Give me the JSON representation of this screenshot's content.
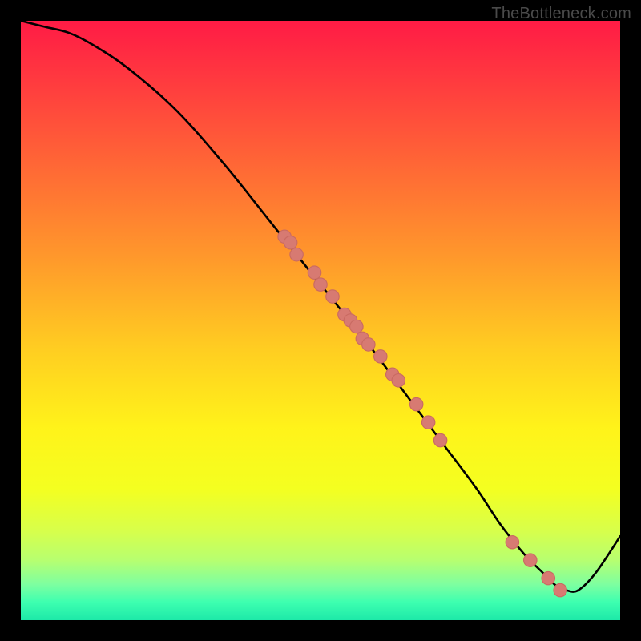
{
  "watermark": "TheBottleneck.com",
  "colors": {
    "black": "#000000",
    "curve": "#000000",
    "point_fill": "#d77a72",
    "point_stroke": "#c96a62",
    "gradient_stops": [
      {
        "offset": 0.0,
        "color": "#ff1b45"
      },
      {
        "offset": 0.1,
        "color": "#ff3a3f"
      },
      {
        "offset": 0.25,
        "color": "#ff6a35"
      },
      {
        "offset": 0.4,
        "color": "#ff9a2b"
      },
      {
        "offset": 0.55,
        "color": "#ffce21"
      },
      {
        "offset": 0.68,
        "color": "#fff31a"
      },
      {
        "offset": 0.78,
        "color": "#f4ff20"
      },
      {
        "offset": 0.85,
        "color": "#d8ff4a"
      },
      {
        "offset": 0.9,
        "color": "#b7ff70"
      },
      {
        "offset": 0.94,
        "color": "#7effa0"
      },
      {
        "offset": 0.97,
        "color": "#3dffb0"
      },
      {
        "offset": 1.0,
        "color": "#1de9a8"
      }
    ]
  },
  "chart_data": {
    "type": "line",
    "title": "",
    "xlabel": "",
    "ylabel": "",
    "xlim": [
      0,
      100
    ],
    "ylim": [
      0,
      100
    ],
    "series": [
      {
        "name": "curve",
        "x": [
          0,
          4,
          8,
          12,
          18,
          26,
          34,
          42,
          50,
          58,
          64,
          70,
          76,
          80,
          84,
          87,
          89,
          91,
          93,
          96,
          100
        ],
        "y": [
          100,
          99,
          98,
          96,
          92,
          85,
          76,
          66,
          56,
          46,
          38,
          30,
          22,
          16,
          11,
          8,
          6,
          5,
          5,
          8,
          14
        ]
      }
    ],
    "points": {
      "name": "markers-on-curve",
      "x": [
        44,
        45,
        46,
        49,
        50,
        52,
        54,
        55,
        56,
        57,
        58,
        60,
        62,
        63,
        66,
        68,
        70,
        82,
        85,
        88,
        90
      ],
      "y": [
        64,
        63,
        61,
        58,
        56,
        54,
        51,
        50,
        49,
        47,
        46,
        44,
        41,
        40,
        36,
        33,
        30,
        13,
        10,
        7,
        5
      ]
    }
  }
}
